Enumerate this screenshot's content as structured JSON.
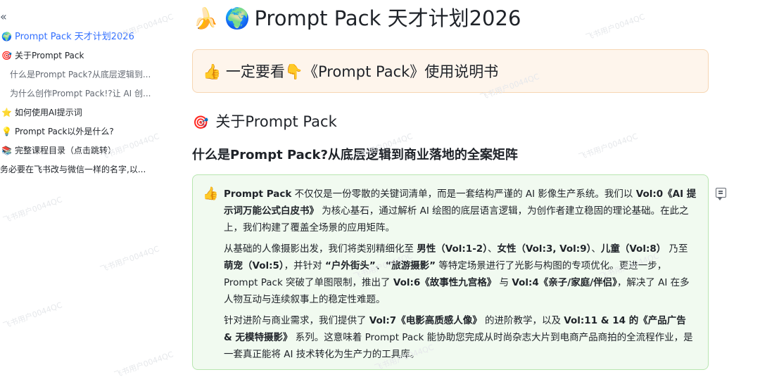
{
  "sidebar": {
    "collapse_glyph": "«",
    "items": [
      {
        "icon": "🌍",
        "label": "Prompt Pack 天才计划2026"
      },
      {
        "icon": "🎯",
        "label": "关于Prompt Pack"
      },
      {
        "icon": "",
        "label": "什么是Prompt Pack?从底层逻辑到..."
      },
      {
        "icon": "",
        "label": "为什么创作Prompt Pack!?让 AI 创..."
      },
      {
        "icon": "⭐",
        "label": "如何使用AI提示词"
      },
      {
        "icon": "💡",
        "label": "Prompt Pack以外是什么?"
      },
      {
        "icon": "📚",
        "label": "完整课程目录（点击跳转）"
      },
      {
        "icon": "",
        "label": "务必要在飞书改与微信一样的名字,以..."
      }
    ]
  },
  "main": {
    "title_icon": "🍌 🌍",
    "title": "Prompt Pack 天才计划2026",
    "callout_orange": {
      "icon": "👍",
      "text": "一定要看👇《Prompt Pack》使用说明书"
    },
    "section_icon": "🎯",
    "section_title": "关于Prompt Pack",
    "subsection_title": "什么是Prompt Pack?从底层逻辑到商业落地的全案矩阵",
    "callout_green": {
      "icon": "👍",
      "p1": {
        "b1": "Prompt Pack",
        "t1": " 不仅仅是一份零散的关键词清单，而是一套结构严谨的 AI 影像生产系统。我们以 ",
        "b2": "Vol:0《AI 提示词万能公式白皮书》",
        "t2": " 为核心基石，通过解析 AI 绘图的底层语言逻辑，为创作者建立稳固的理论基础。在此之上，我们构建了覆盖全场景的应用矩阵。"
      },
      "p2": {
        "t1": "从基础的人像摄影出发，我们将类别精细化至 ",
        "b1": "男性（Vol:1-2）",
        "t2": "、",
        "b2": "女性（Vol:3, Vol:9）",
        "t3": "、",
        "b3": "儿童（Vol:8）",
        "t4": " 乃至 ",
        "b4": "萌宠（Vol:5）",
        "t5": "，并针对 ",
        "b5": "“户外街头”、“旅游摄影”",
        "t6": " 等特定场景进行了光影与构图的专项优化。更进一步，Prompt Pack 突破了单图限制，推出了 ",
        "b6": "Vol:6《故事性九宫格》",
        "t7": " 与 ",
        "b7": "Vol:4《亲子/家庭/伴侣》",
        "t8": "，解决了 AI 在多人物互动与连续叙事上的稳定性难题。"
      },
      "p3": {
        "t1": "针对进阶与商业需求，我们提供了 ",
        "b1": "Vol:7《电影高质感人像》",
        "t2": " 的进阶教学，以及 ",
        "b2": "Vol:11 & 14 的《产品广告 & 无模特摄影》",
        "t3": " 系列。这意味着 Prompt Pack 能协助您完成从时尚杂志大片到电商产品商拍的全流程作业，是一套真正能将 AI 技术转化为生产力的工具库。"
      }
    }
  },
  "watermark": "飞书用户0044QC",
  "colors": {
    "accent": "#3370ff",
    "orange_bg": "#fef5ec",
    "orange_border": "#f6d6b3",
    "green_bg": "#f1faf0",
    "green_border": "#b8e6b0"
  }
}
